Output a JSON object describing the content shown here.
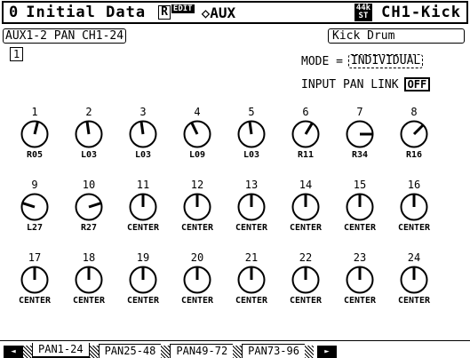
{
  "title_bar": {
    "scene_number": "0",
    "scene_name": "Initial Data",
    "r_badge": "R",
    "edit_badge": "EDIT",
    "page_name": "◇AUX",
    "fs_top": "44k",
    "fs_bottom": "ST",
    "channel": "CH1-Kick"
  },
  "header": {
    "aux_label": "AUX1-2 PAN CH1-24",
    "channel_name": "Kick Drum",
    "page_number": "1",
    "mode_label": "MODE =",
    "mode_value": "INDIVIDUAL",
    "input_pan_link_label": "INPUT PAN LINK",
    "input_pan_link_value": "OFF"
  },
  "knobs": [
    {
      "num": "1",
      "value": "R05",
      "angle": 14
    },
    {
      "num": "2",
      "value": "L03",
      "angle": -8
    },
    {
      "num": "3",
      "value": "L03",
      "angle": -8
    },
    {
      "num": "4",
      "value": "L09",
      "angle": -26
    },
    {
      "num": "5",
      "value": "L03",
      "angle": -8
    },
    {
      "num": "6",
      "value": "R11",
      "angle": 31
    },
    {
      "num": "7",
      "value": "R34",
      "angle": 90
    },
    {
      "num": "8",
      "value": "R16",
      "angle": 45
    },
    {
      "num": "9",
      "value": "L27",
      "angle": -72
    },
    {
      "num": "10",
      "value": "R27",
      "angle": 72
    },
    {
      "num": "11",
      "value": "CENTER",
      "angle": 0
    },
    {
      "num": "12",
      "value": "CENTER",
      "angle": 0
    },
    {
      "num": "13",
      "value": "CENTER",
      "angle": 0
    },
    {
      "num": "14",
      "value": "CENTER",
      "angle": 0
    },
    {
      "num": "15",
      "value": "CENTER",
      "angle": 0
    },
    {
      "num": "16",
      "value": "CENTER",
      "angle": 0
    },
    {
      "num": "17",
      "value": "CENTER",
      "angle": 0
    },
    {
      "num": "18",
      "value": "CENTER",
      "angle": 0
    },
    {
      "num": "19",
      "value": "CENTER",
      "angle": 0
    },
    {
      "num": "20",
      "value": "CENTER",
      "angle": 0
    },
    {
      "num": "21",
      "value": "CENTER",
      "angle": 0
    },
    {
      "num": "22",
      "value": "CENTER",
      "angle": 0
    },
    {
      "num": "23",
      "value": "CENTER",
      "angle": 0
    },
    {
      "num": "24",
      "value": "CENTER",
      "angle": 0
    }
  ],
  "tabs": {
    "left_arrow": "◄",
    "right_arrow": "►",
    "items": [
      "PAN1-24",
      "PAN25-48",
      "PAN49-72",
      "PAN73-96"
    ],
    "active_index": 0
  }
}
